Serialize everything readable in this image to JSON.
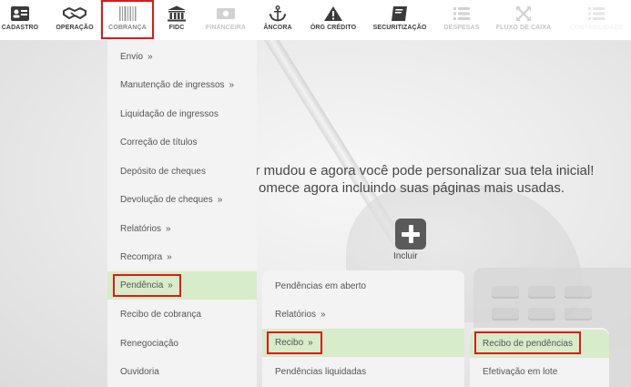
{
  "toolbar": {
    "items": [
      {
        "label": "CADASTRO",
        "icon": "id-card-icon"
      },
      {
        "label": "OPERAÇÃO",
        "icon": "handshake-icon"
      },
      {
        "label": "COBRANÇA",
        "icon": "barcode-icon"
      },
      {
        "label": "FIDC",
        "icon": "bank-icon"
      },
      {
        "label": "FINANCEIRA",
        "icon": "money-bill-icon"
      },
      {
        "label": "ÂNCORA",
        "icon": "anchor-icon"
      },
      {
        "label": "ÓRG CRÉDITO",
        "icon": "warning-icon"
      },
      {
        "label": "SECURITIZAÇÃO",
        "icon": "book-icon"
      },
      {
        "label": "DESPESAS",
        "icon": "list-icon"
      },
      {
        "label": "FLUXO DE CAIXA",
        "icon": "arrows-icon"
      },
      {
        "label": "CONTABILIDADE",
        "icon": "list-icon"
      }
    ]
  },
  "welcome": {
    "line1": "tor mudou e agora você pode personalizar sua tela inicial!",
    "line2": "omece agora incluindo suas páginas mais usadas."
  },
  "incluir_label": "Incluir",
  "menu_cobranca": {
    "items": [
      {
        "label": "Envio",
        "chevron": "»"
      },
      {
        "label": "Manutenção de ingressos",
        "chevron": "»"
      },
      {
        "label": "Liquidação de ingressos",
        "chevron": ""
      },
      {
        "label": "Correção de títulos",
        "chevron": ""
      },
      {
        "label": "Depósito de cheques",
        "chevron": ""
      },
      {
        "label": "Devolução de cheques",
        "chevron": "»"
      },
      {
        "label": "Relatórios",
        "chevron": "»"
      },
      {
        "label": "Recompra",
        "chevron": "»"
      },
      {
        "label": "Pendência",
        "chevron": "»"
      },
      {
        "label": "Recibo de cobrança",
        "chevron": ""
      },
      {
        "label": "Renegociação",
        "chevron": ""
      },
      {
        "label": "Ouvidoria",
        "chevron": ""
      }
    ]
  },
  "menu_pendencia": {
    "items": [
      {
        "label": "Pendências em aberto",
        "chevron": ""
      },
      {
        "label": "Relatórios",
        "chevron": "»"
      },
      {
        "label": "Recibo",
        "chevron": "»"
      },
      {
        "label": "Pendências liquidadas",
        "chevron": ""
      }
    ]
  },
  "menu_recibo": {
    "items": [
      {
        "label": "Recibo de pendências",
        "chevron": ""
      },
      {
        "label": "Efetivação em lote",
        "chevron": ""
      }
    ]
  },
  "colors": {
    "highlight_red": "#e01818",
    "selected_green": "#d7ecc9",
    "menu_bg": "#f3f3f3",
    "toolbar_text": "#3c3c3c",
    "disabled_text": "#c6c6c6"
  }
}
